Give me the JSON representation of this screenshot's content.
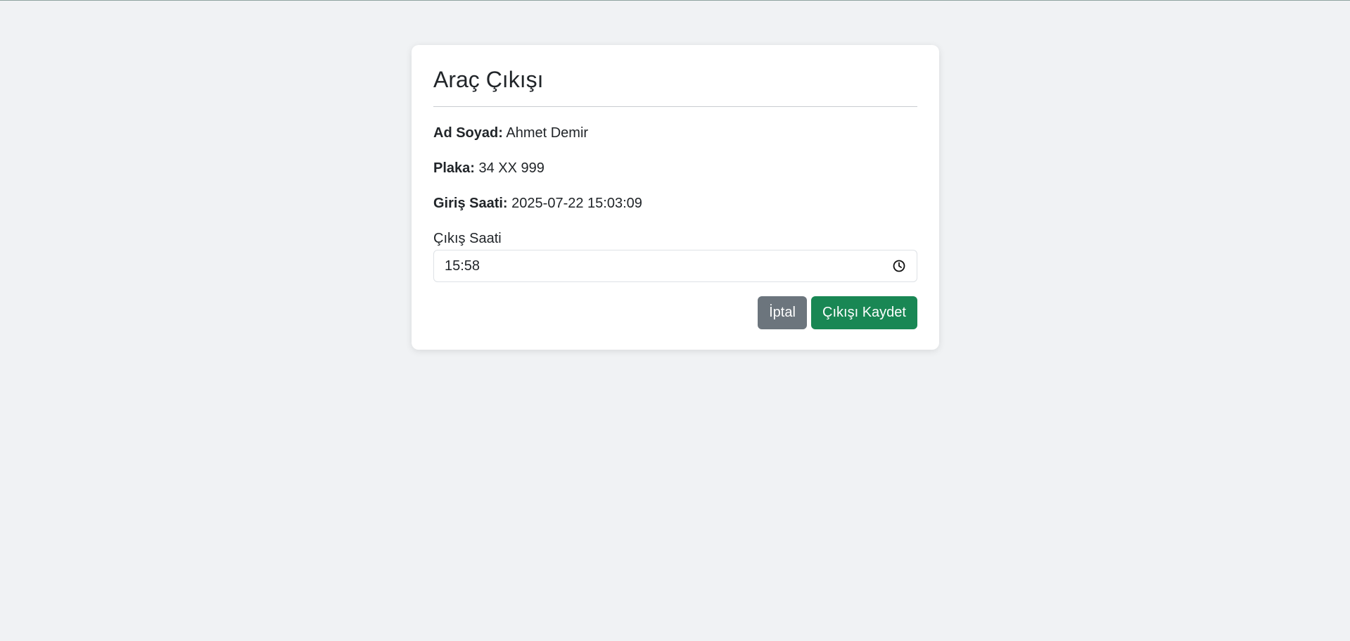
{
  "page": {
    "title": "Araç Çıkışı"
  },
  "info": {
    "name_label": "Ad Soyad:",
    "name_value": "Ahmet Demir",
    "plate_label": "Plaka:",
    "plate_value": "34 XX 999",
    "entry_label": "Giriş Saati:",
    "entry_value": "2025-07-22 15:03:09"
  },
  "exit_time": {
    "label": "Çıkış Saati",
    "value": "15:58",
    "icon": "clock-icon"
  },
  "actions": {
    "cancel_label": "İptal",
    "save_label": "Çıkışı Kaydet"
  },
  "colors": {
    "background": "#f0f2f4",
    "cancel_button": "#6c757d",
    "save_button": "#198754"
  }
}
